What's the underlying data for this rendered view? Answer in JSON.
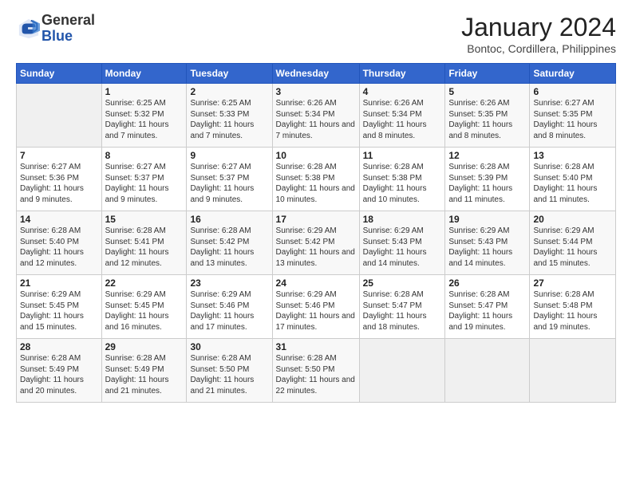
{
  "header": {
    "logo": {
      "general": "General",
      "blue": "Blue"
    },
    "title": "January 2024",
    "location": "Bontoc, Cordillera, Philippines"
  },
  "weekdays": [
    "Sunday",
    "Monday",
    "Tuesday",
    "Wednesday",
    "Thursday",
    "Friday",
    "Saturday"
  ],
  "weeks": [
    [
      {
        "day": "",
        "sunrise": "",
        "sunset": "",
        "daylight": ""
      },
      {
        "day": "1",
        "sunrise": "Sunrise: 6:25 AM",
        "sunset": "Sunset: 5:32 PM",
        "daylight": "Daylight: 11 hours and 7 minutes."
      },
      {
        "day": "2",
        "sunrise": "Sunrise: 6:25 AM",
        "sunset": "Sunset: 5:33 PM",
        "daylight": "Daylight: 11 hours and 7 minutes."
      },
      {
        "day": "3",
        "sunrise": "Sunrise: 6:26 AM",
        "sunset": "Sunset: 5:34 PM",
        "daylight": "Daylight: 11 hours and 7 minutes."
      },
      {
        "day": "4",
        "sunrise": "Sunrise: 6:26 AM",
        "sunset": "Sunset: 5:34 PM",
        "daylight": "Daylight: 11 hours and 8 minutes."
      },
      {
        "day": "5",
        "sunrise": "Sunrise: 6:26 AM",
        "sunset": "Sunset: 5:35 PM",
        "daylight": "Daylight: 11 hours and 8 minutes."
      },
      {
        "day": "6",
        "sunrise": "Sunrise: 6:27 AM",
        "sunset": "Sunset: 5:35 PM",
        "daylight": "Daylight: 11 hours and 8 minutes."
      }
    ],
    [
      {
        "day": "7",
        "sunrise": "Sunrise: 6:27 AM",
        "sunset": "Sunset: 5:36 PM",
        "daylight": "Daylight: 11 hours and 9 minutes."
      },
      {
        "day": "8",
        "sunrise": "Sunrise: 6:27 AM",
        "sunset": "Sunset: 5:37 PM",
        "daylight": "Daylight: 11 hours and 9 minutes."
      },
      {
        "day": "9",
        "sunrise": "Sunrise: 6:27 AM",
        "sunset": "Sunset: 5:37 PM",
        "daylight": "Daylight: 11 hours and 9 minutes."
      },
      {
        "day": "10",
        "sunrise": "Sunrise: 6:28 AM",
        "sunset": "Sunset: 5:38 PM",
        "daylight": "Daylight: 11 hours and 10 minutes."
      },
      {
        "day": "11",
        "sunrise": "Sunrise: 6:28 AM",
        "sunset": "Sunset: 5:38 PM",
        "daylight": "Daylight: 11 hours and 10 minutes."
      },
      {
        "day": "12",
        "sunrise": "Sunrise: 6:28 AM",
        "sunset": "Sunset: 5:39 PM",
        "daylight": "Daylight: 11 hours and 11 minutes."
      },
      {
        "day": "13",
        "sunrise": "Sunrise: 6:28 AM",
        "sunset": "Sunset: 5:40 PM",
        "daylight": "Daylight: 11 hours and 11 minutes."
      }
    ],
    [
      {
        "day": "14",
        "sunrise": "Sunrise: 6:28 AM",
        "sunset": "Sunset: 5:40 PM",
        "daylight": "Daylight: 11 hours and 12 minutes."
      },
      {
        "day": "15",
        "sunrise": "Sunrise: 6:28 AM",
        "sunset": "Sunset: 5:41 PM",
        "daylight": "Daylight: 11 hours and 12 minutes."
      },
      {
        "day": "16",
        "sunrise": "Sunrise: 6:28 AM",
        "sunset": "Sunset: 5:42 PM",
        "daylight": "Daylight: 11 hours and 13 minutes."
      },
      {
        "day": "17",
        "sunrise": "Sunrise: 6:29 AM",
        "sunset": "Sunset: 5:42 PM",
        "daylight": "Daylight: 11 hours and 13 minutes."
      },
      {
        "day": "18",
        "sunrise": "Sunrise: 6:29 AM",
        "sunset": "Sunset: 5:43 PM",
        "daylight": "Daylight: 11 hours and 14 minutes."
      },
      {
        "day": "19",
        "sunrise": "Sunrise: 6:29 AM",
        "sunset": "Sunset: 5:43 PM",
        "daylight": "Daylight: 11 hours and 14 minutes."
      },
      {
        "day": "20",
        "sunrise": "Sunrise: 6:29 AM",
        "sunset": "Sunset: 5:44 PM",
        "daylight": "Daylight: 11 hours and 15 minutes."
      }
    ],
    [
      {
        "day": "21",
        "sunrise": "Sunrise: 6:29 AM",
        "sunset": "Sunset: 5:45 PM",
        "daylight": "Daylight: 11 hours and 15 minutes."
      },
      {
        "day": "22",
        "sunrise": "Sunrise: 6:29 AM",
        "sunset": "Sunset: 5:45 PM",
        "daylight": "Daylight: 11 hours and 16 minutes."
      },
      {
        "day": "23",
        "sunrise": "Sunrise: 6:29 AM",
        "sunset": "Sunset: 5:46 PM",
        "daylight": "Daylight: 11 hours and 17 minutes."
      },
      {
        "day": "24",
        "sunrise": "Sunrise: 6:29 AM",
        "sunset": "Sunset: 5:46 PM",
        "daylight": "Daylight: 11 hours and 17 minutes."
      },
      {
        "day": "25",
        "sunrise": "Sunrise: 6:28 AM",
        "sunset": "Sunset: 5:47 PM",
        "daylight": "Daylight: 11 hours and 18 minutes."
      },
      {
        "day": "26",
        "sunrise": "Sunrise: 6:28 AM",
        "sunset": "Sunset: 5:47 PM",
        "daylight": "Daylight: 11 hours and 19 minutes."
      },
      {
        "day": "27",
        "sunrise": "Sunrise: 6:28 AM",
        "sunset": "Sunset: 5:48 PM",
        "daylight": "Daylight: 11 hours and 19 minutes."
      }
    ],
    [
      {
        "day": "28",
        "sunrise": "Sunrise: 6:28 AM",
        "sunset": "Sunset: 5:49 PM",
        "daylight": "Daylight: 11 hours and 20 minutes."
      },
      {
        "day": "29",
        "sunrise": "Sunrise: 6:28 AM",
        "sunset": "Sunset: 5:49 PM",
        "daylight": "Daylight: 11 hours and 21 minutes."
      },
      {
        "day": "30",
        "sunrise": "Sunrise: 6:28 AM",
        "sunset": "Sunset: 5:50 PM",
        "daylight": "Daylight: 11 hours and 21 minutes."
      },
      {
        "day": "31",
        "sunrise": "Sunrise: 6:28 AM",
        "sunset": "Sunset: 5:50 PM",
        "daylight": "Daylight: 11 hours and 22 minutes."
      },
      {
        "day": "",
        "sunrise": "",
        "sunset": "",
        "daylight": ""
      },
      {
        "day": "",
        "sunrise": "",
        "sunset": "",
        "daylight": ""
      },
      {
        "day": "",
        "sunrise": "",
        "sunset": "",
        "daylight": ""
      }
    ]
  ]
}
